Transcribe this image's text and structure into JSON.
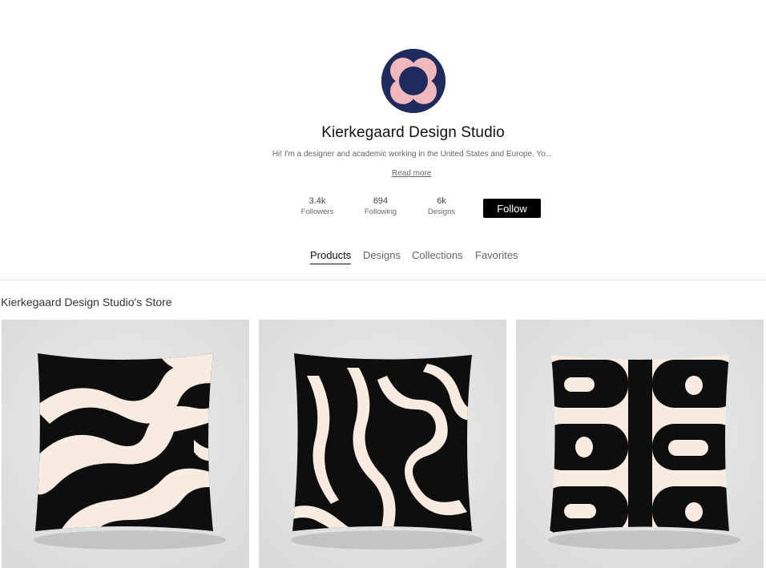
{
  "profile": {
    "shop_name": "Kierkegaard Design Studio",
    "bio": "Hi! I'm a designer and academic working in the United States and Europe. Yo...",
    "read_more": "Read more",
    "stats": [
      {
        "value": "3.4k",
        "label": "Followers"
      },
      {
        "value": "694",
        "label": "Following"
      },
      {
        "value": "6k",
        "label": "Designs"
      }
    ],
    "follow_label": "Follow",
    "avatar_colors": {
      "background": "#1e2b5c",
      "petals": "#f0b8bb"
    }
  },
  "tabs": [
    {
      "label": "Products",
      "active": true
    },
    {
      "label": "Designs",
      "active": false
    },
    {
      "label": "Collections",
      "active": false
    },
    {
      "label": "Favorites",
      "active": false
    }
  ],
  "store": {
    "title": "Kierkegaard Design Studio's Store",
    "products": [
      {
        "pattern": "liquid-swirl-wide"
      },
      {
        "pattern": "liquid-swirl-narrow"
      },
      {
        "pattern": "mid-century-pod"
      }
    ]
  },
  "colors": {
    "pillow_black": "#0e0e0e",
    "pillow_cream": "#f7ecdf",
    "card_bg": "#e4e5e6",
    "button_bg": "#000000"
  }
}
